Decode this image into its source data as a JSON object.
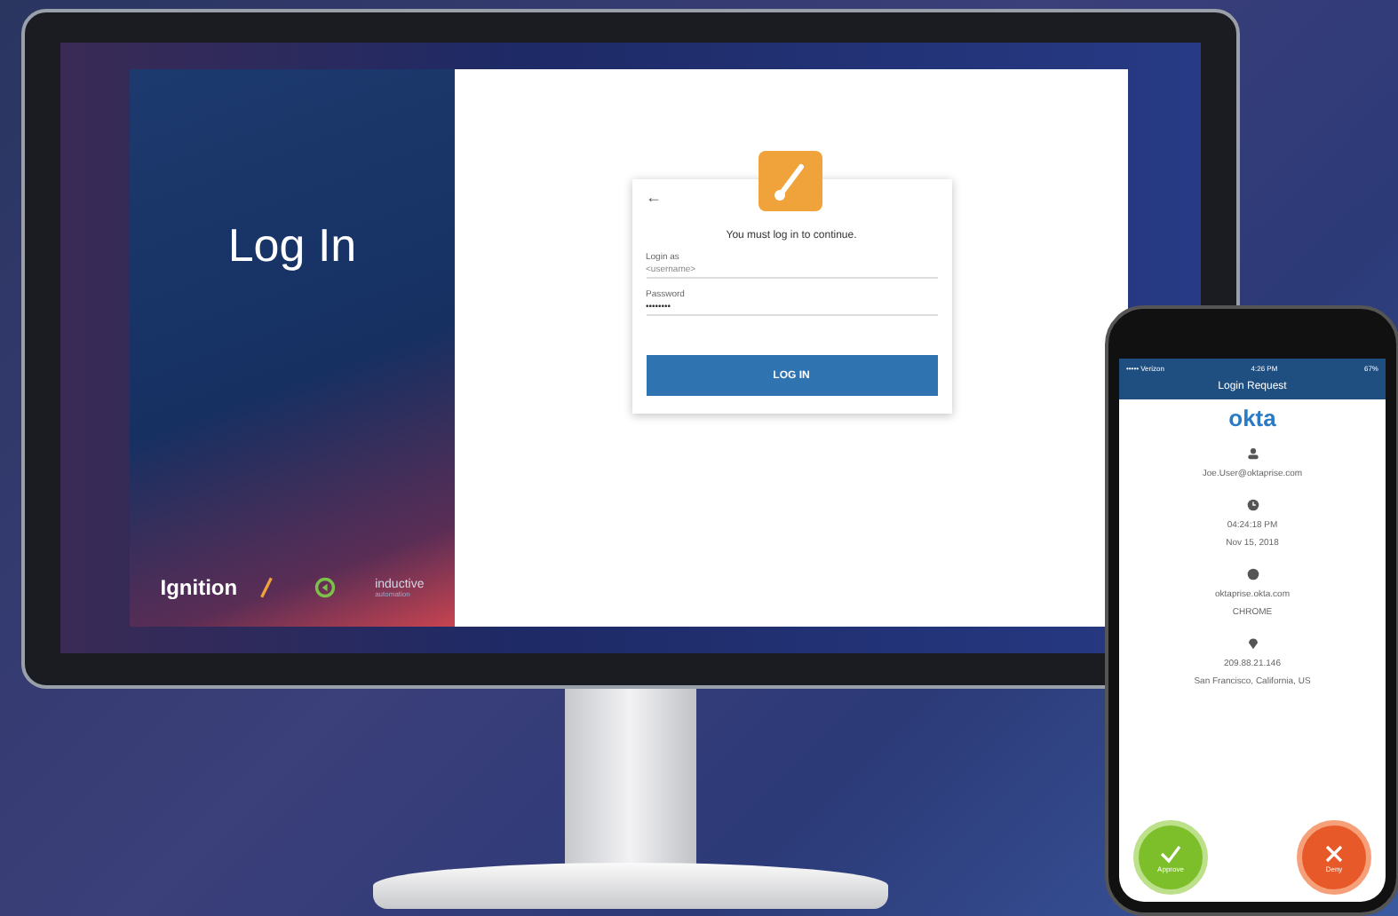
{
  "monitor": {
    "login_page": {
      "title": "Log In",
      "brand": "Ignition",
      "partner_logo": "inductive",
      "partner_subtitle": "automation",
      "card": {
        "back": "←",
        "message": "You must log in to continue.",
        "user_label": "Login as",
        "user_value": "<username>",
        "password_label": "Password",
        "password_value": "••••••••",
        "button": "LOG IN"
      }
    }
  },
  "phone": {
    "status_bar": {
      "carrier": "••••• Verizon",
      "time": "4:26 PM",
      "battery": "67%"
    },
    "header": "Login Request",
    "brand": "okta",
    "details": [
      {
        "kind": "user",
        "lines": [
          "Joe.User@oktaprise.com"
        ]
      },
      {
        "kind": "time",
        "lines": [
          "04:24:18 PM",
          "Nov 15, 2018"
        ]
      },
      {
        "kind": "browser",
        "lines": [
          "oktaprise.okta.com",
          "CHROME"
        ]
      },
      {
        "kind": "location",
        "lines": [
          "209.88.21.146",
          "San Francisco, California, US"
        ]
      }
    ],
    "actions": [
      {
        "kind": "approve",
        "label": "Approve"
      },
      {
        "kind": "deny",
        "label": "Deny"
      }
    ]
  }
}
